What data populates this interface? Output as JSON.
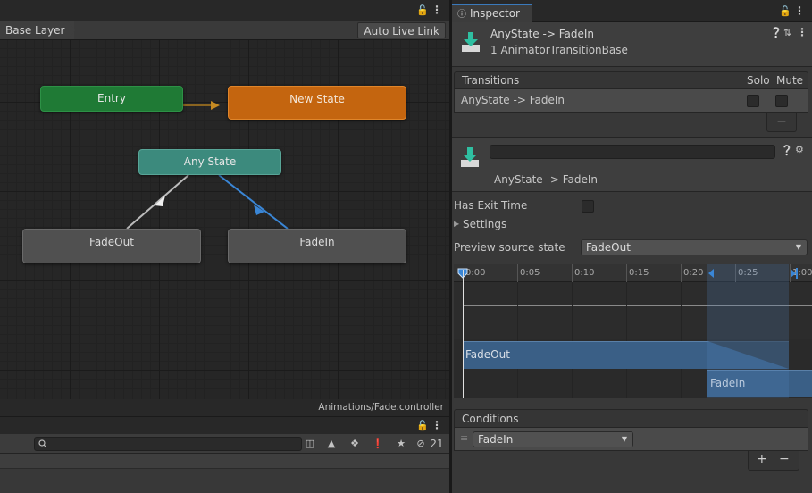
{
  "animator": {
    "breadcrumb": "Base Layer",
    "auto_live_link_label": "Auto Live Link",
    "nodes": {
      "entry": "Entry",
      "new_state": "New State",
      "any_state": "Any State",
      "fade_out": "FadeOut",
      "fade_in": "FadeIn"
    },
    "controller_path": "Animations/Fade.controller",
    "colors": {
      "entry": "#1f7a35",
      "default_state": "#c4650f",
      "any_state": "#3c8a7d",
      "state": "#505050",
      "selected_transition": "#3a86d6"
    }
  },
  "bottom_panel": {
    "search_placeholder": "",
    "hidden_count": "21",
    "icons": [
      "search-icon",
      "scene-icon",
      "type-filter-icon",
      "label-filter-icon",
      "warning-icon",
      "favorite-icon",
      "visibility-icon"
    ]
  },
  "inspector": {
    "tab_label": "Inspector",
    "header_title": "AnyState -> FadeIn",
    "header_subtitle": "1 AnimatorTransitionBase",
    "transitions": {
      "heading": "Transitions",
      "solo_label": "Solo",
      "mute_label": "Mute",
      "rows": [
        {
          "name": "AnyState -> FadeIn",
          "solo": false,
          "mute": false
        }
      ],
      "remove_label": "−"
    },
    "transition": {
      "name_value": "",
      "label": "AnyState -> FadeIn",
      "has_exit_time_label": "Has Exit Time",
      "has_exit_time": false,
      "settings_label": "Settings",
      "preview_source_label": "Preview source state",
      "preview_source_value": "FadeOut"
    },
    "timeline": {
      "ticks": [
        "0:00",
        "0:05",
        "0:10",
        "0:15",
        "0:20",
        "0:25",
        "1:00"
      ],
      "clip_from": "FadeOut",
      "clip_to": "FadeIn"
    },
    "conditions": {
      "heading": "Conditions",
      "items": [
        {
          "parameter": "FadeIn"
        }
      ],
      "add_label": "+",
      "remove_label": "−"
    }
  }
}
